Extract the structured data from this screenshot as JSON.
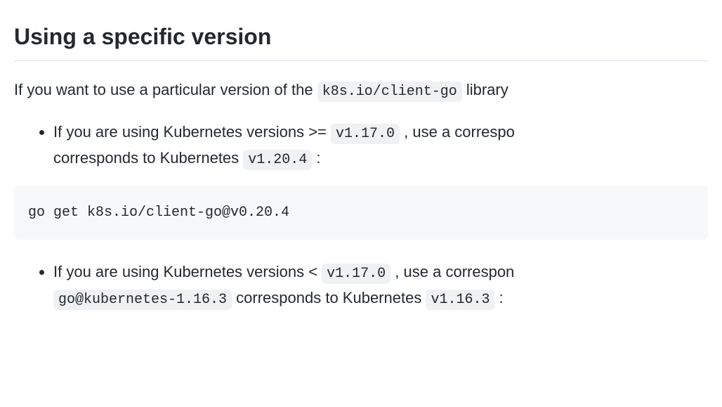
{
  "heading": "Using a specific version",
  "intro": {
    "text1": "If you want to use a particular version of the ",
    "code1": "k8s.io/client-go",
    "text2": " library"
  },
  "bullet1": {
    "text1": "If you are using Kubernetes versions >= ",
    "code1": "v1.17.0",
    "text2": " , use a correspo",
    "text3": "corresponds to Kubernetes ",
    "code2": "v1.20.4",
    "text4": " :"
  },
  "codeblock1": "go get k8s.io/client-go@v0.20.4",
  "bullet2": {
    "text1": "If you are using Kubernetes versions < ",
    "code1": "v1.17.0",
    "text2": " , use a correspon",
    "code2": "go@kubernetes-1.16.3",
    "text3": " corresponds to Kubernetes ",
    "code3": "v1.16.3",
    "text4": " :"
  }
}
